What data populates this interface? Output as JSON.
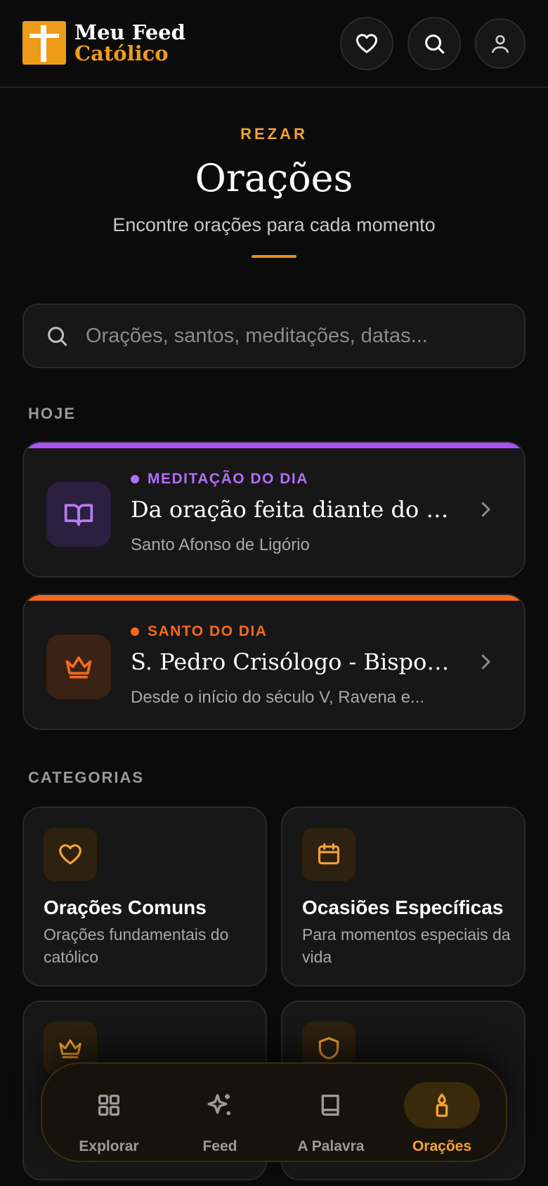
{
  "header": {
    "logo_line1": "Meu Feed",
    "logo_line2": "Católico",
    "favorites_icon": "heart-icon",
    "search_icon": "search-icon",
    "profile_icon": "user-icon"
  },
  "hero": {
    "kicker": "REZAR",
    "title": "Orações",
    "subtitle": "Encontre orações para cada momento"
  },
  "search": {
    "placeholder": "Orações, santos, meditações, datas...",
    "value": ""
  },
  "today": {
    "label": "HOJE",
    "cards": [
      {
        "tag": "MEDITAÇÃO DO DIA",
        "title": "Da oração feita diante do S...",
        "subtitle": "Santo Afonso de Ligório",
        "icon": "book-open-icon",
        "accent": "#a855f7"
      },
      {
        "tag": "SANTO DO DIA",
        "title": "S. Pedro Crisólogo - Bispo d...",
        "subtitle": "Desde o início do século V, Ravena e...",
        "icon": "crown-icon",
        "accent": "#f26a1b"
      }
    ]
  },
  "categories": {
    "label": "CATEGORIAS",
    "items": [
      {
        "title": "Orações Comuns",
        "desc": "Orações fundamentais do católico",
        "icon": "heart-icon"
      },
      {
        "title": "Ocasiões Específicas",
        "desc": "Para momentos especiais da vida",
        "icon": "calendar-icon"
      },
      {
        "title": "",
        "desc": "",
        "icon": "crown-icon"
      },
      {
        "title": "",
        "desc": "",
        "icon": "shield-icon"
      }
    ]
  },
  "nav": {
    "items": [
      {
        "label": "Explorar",
        "icon": "grid-icon"
      },
      {
        "label": "Feed",
        "icon": "sparkles-icon"
      },
      {
        "label": "A Palavra",
        "icon": "book-icon"
      },
      {
        "label": "Orações",
        "icon": "candle-icon"
      }
    ],
    "active": "Orações"
  },
  "colors": {
    "accent": "#f2a233",
    "background": "#0b0b0b",
    "card": "#171717",
    "meditation": "#a855f7",
    "saint": "#f26a1b"
  }
}
